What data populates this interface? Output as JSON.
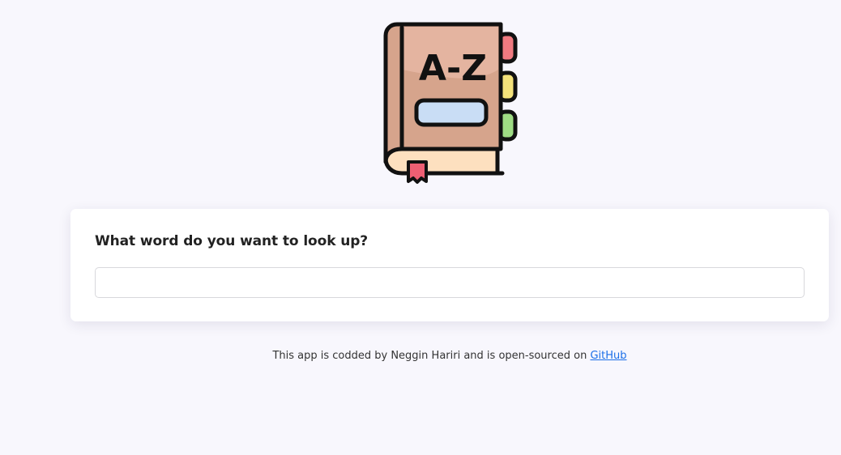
{
  "logo": {
    "icon": "dictionary-book-icon",
    "cover_text": "A-Z",
    "colors": {
      "cover": "#d6a48c",
      "cover_top": "#e4b4a0",
      "outline": "#111111",
      "label": "#c9ddf5",
      "tab_red": "#f07a80",
      "tab_yellow": "#f4e27a",
      "tab_green": "#9fdc84",
      "bookmark": "#ee5f73",
      "pages": "#fde0bf"
    }
  },
  "search_card": {
    "question": "What word do you want to look up?",
    "input_value": "",
    "input_placeholder": ""
  },
  "footer": {
    "text": "This app is codded by Neggin Hariri and is open-sourced on",
    "link_label": "GitHub"
  }
}
